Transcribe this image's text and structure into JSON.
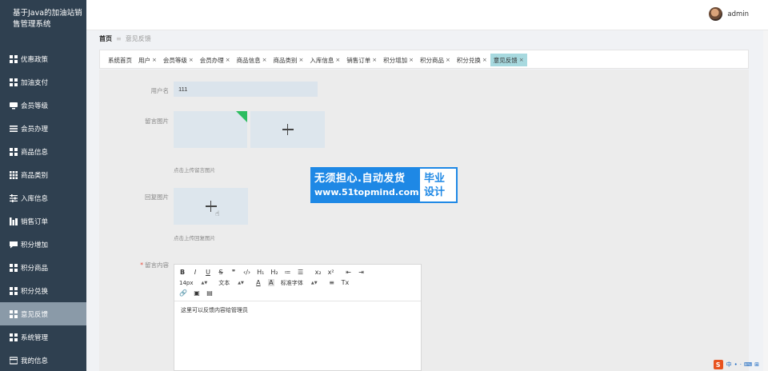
{
  "app": {
    "title": "基于Java的加油站销售管理系统"
  },
  "user": {
    "name": "admin"
  },
  "sidebar": {
    "items": [
      {
        "label": "优惠政策",
        "icon": "grid-icon"
      },
      {
        "label": "加油支付",
        "icon": "grid-icon"
      },
      {
        "label": "会员等级",
        "icon": "monitor-icon"
      },
      {
        "label": "会员办理",
        "icon": "list-icon"
      },
      {
        "label": "商品信息",
        "icon": "grid-icon"
      },
      {
        "label": "商品类别",
        "icon": "apps-icon"
      },
      {
        "label": "入库信息",
        "icon": "sliders-icon"
      },
      {
        "label": "销售订单",
        "icon": "bar-icon"
      },
      {
        "label": "积分增加",
        "icon": "comment-icon"
      },
      {
        "label": "积分商品",
        "icon": "grid-icon"
      },
      {
        "label": "积分兑换",
        "icon": "grid-icon"
      },
      {
        "label": "意见反馈",
        "icon": "grid-icon"
      },
      {
        "label": "系统管理",
        "icon": "grid-icon"
      },
      {
        "label": "我的信息",
        "icon": "card-icon"
      }
    ]
  },
  "breadcrumb": {
    "home": "首页",
    "separator": "≡",
    "current": "意见反馈"
  },
  "tabs": [
    {
      "label": "系统首页",
      "closable": false
    },
    {
      "label": "用户",
      "closable": true
    },
    {
      "label": "会员等级",
      "closable": true
    },
    {
      "label": "会员办理",
      "closable": true
    },
    {
      "label": "商品信息",
      "closable": true
    },
    {
      "label": "商品类别",
      "closable": true
    },
    {
      "label": "入库信息",
      "closable": true
    },
    {
      "label": "销售订单",
      "closable": true
    },
    {
      "label": "积分增加",
      "closable": true
    },
    {
      "label": "积分商品",
      "closable": true
    },
    {
      "label": "积分兑换",
      "closable": true
    },
    {
      "label": "意见反馈",
      "closable": true
    }
  ],
  "form": {
    "username_label": "用户名",
    "username_value": "111",
    "msg_image_label": "留言图片",
    "msg_image_hint": "点击上传留言图片",
    "reply_image_label": "回复图片",
    "reply_image_hint": "点击上传回复图片",
    "content_label": "留言内容",
    "content_required": "*",
    "content_value": "这里可以反馈内容给管理员"
  },
  "editor": {
    "row1": [
      "B",
      "I",
      "U",
      "S",
      "❞",
      "‹/›",
      "H₁",
      "H₂",
      "≔",
      "☰",
      "x₂",
      "x²",
      "⇤",
      "⇥"
    ],
    "font_size": "14px",
    "format": "文本",
    "font_family": "标准字体",
    "color_icon": "A",
    "bg_icon": "A",
    "align_icon": "≡",
    "clear_icon": "Tx"
  },
  "watermark": {
    "line1": "无须担心.自动发货",
    "line2": "www.51topmind.com",
    "right1": "毕业",
    "right2": "设计"
  },
  "tray": {
    "logo": "S",
    "lang": "中",
    "items": [
      "•",
      "·",
      "⌨",
      "⊞"
    ]
  },
  "colors": {
    "sidebar": "#2f4050",
    "active_tab": "#a7d9df",
    "active_menu": "#8a9aa8",
    "accent": "#1e88e5",
    "upload_corner": "#2dbd5f"
  }
}
